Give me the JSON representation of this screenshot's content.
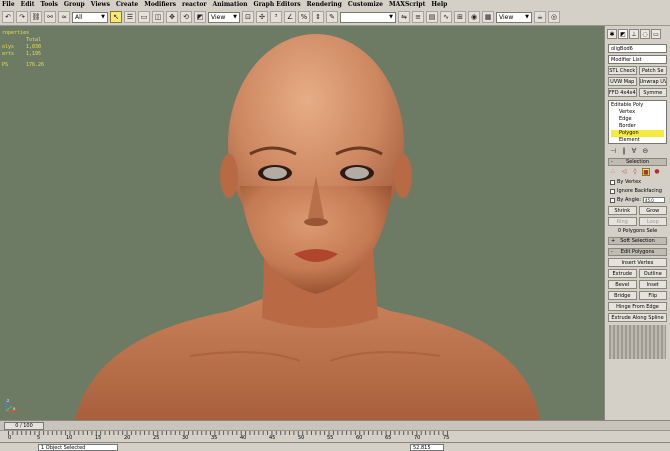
{
  "menu": {
    "items": [
      "File",
      "Edit",
      "Tools",
      "Group",
      "Views",
      "Create",
      "Modifiers",
      "reactor",
      "Animation",
      "Graph Editors",
      "Rendering",
      "Customize",
      "MAXScript",
      "Help"
    ]
  },
  "toolbar": {
    "selection_filter": "All",
    "reference_coord": "View",
    "named_selection": "",
    "render_view": "View"
  },
  "viewport": {
    "stats": {
      "header": "roperties",
      "total_label": "Total",
      "polys_label": "olys",
      "polys_value": "1,030",
      "verts_label": "erts",
      "verts_value": "1,195",
      "fps_label": "PS",
      "fps_value": "176.26"
    },
    "axis_labels": {
      "x": "x",
      "y": "y",
      "z": "z"
    }
  },
  "command_panel": {
    "object_name": "oligBod6",
    "modifier_list": "Modifier List",
    "buttons_row1": [
      "STL Check",
      "Patch Se"
    ],
    "buttons_row2": [
      "UVW Map",
      "Unwrap UV"
    ],
    "buttons_row3": [
      "FFD 4x4x4",
      "Symme"
    ],
    "stack": {
      "base": "Editable Poly",
      "subs": [
        "Vertex",
        "Edge",
        "Border",
        "Polygon",
        "Element"
      ],
      "selected": "Polygon"
    },
    "selection_rollout": "Selection",
    "by_vertex": "By Vertex",
    "ignore_backfacing": "Ignore Backfacing",
    "by_angle": "By Angle:",
    "by_angle_value": "45.0",
    "shrink": "Shrink",
    "grow": "Grow",
    "ring": "Ring",
    "loop": "Loop",
    "polygons_selected": "0 Polygons Sele",
    "soft_selection": "Soft Selection",
    "edit_polygons": "Edit Polygons",
    "insert_vertex": "Insert Vertex",
    "extrude": "Extrude",
    "outline": "Outline",
    "bevel": "Bevel",
    "inset": "Inset",
    "bridge": "Bridge",
    "flip": "Flip",
    "hinge_from_edge": "Hinge From Edge",
    "extrude_along_spline": "Extrude Along Spline"
  },
  "timeline": {
    "frame": "0 / 100",
    "ticks": [
      "0",
      "5",
      "10",
      "15",
      "20",
      "25",
      "30",
      "35",
      "40",
      "45",
      "50",
      "55",
      "60",
      "65",
      "70",
      "75"
    ]
  },
  "status": {
    "selected": "1 Object Selected",
    "coord_value": "52.815"
  },
  "colors": {
    "viewport_bg": "#6e7b64",
    "stats_text": "#e3e048",
    "stack_highlight": "#f7ea3e",
    "skin": "#c47a52"
  }
}
